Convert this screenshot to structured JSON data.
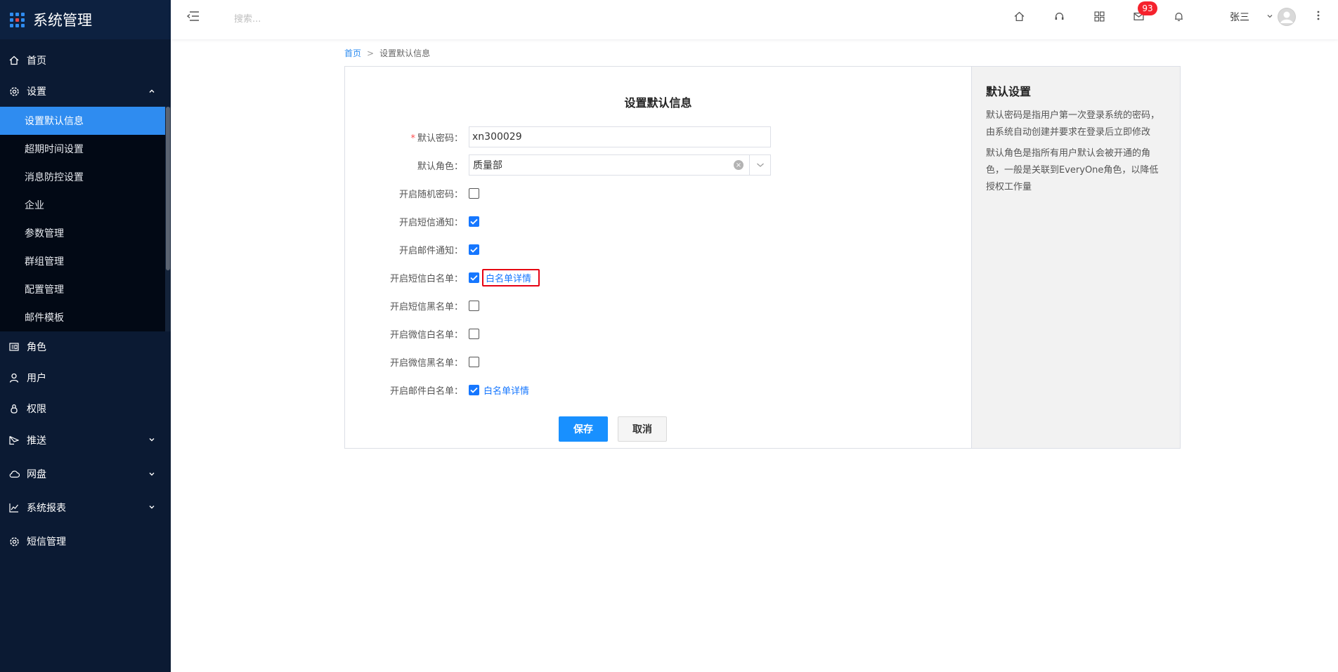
{
  "app": {
    "title": "系统管理"
  },
  "sidebar": {
    "items": [
      {
        "label": "首页",
        "icon": "home-icon"
      },
      {
        "label": "设置",
        "icon": "gear-icon",
        "expanded": true
      },
      {
        "label": "角色",
        "icon": "id-card-icon"
      },
      {
        "label": "用户",
        "icon": "user-icon"
      },
      {
        "label": "权限",
        "icon": "lock-icon"
      },
      {
        "label": "推送",
        "icon": "send-icon"
      },
      {
        "label": "网盘",
        "icon": "cloud-icon"
      },
      {
        "label": "系统报表",
        "icon": "chart-icon"
      },
      {
        "label": "短信管理",
        "icon": "gear-icon"
      }
    ],
    "settings_sub": [
      {
        "label": "设置默认信息",
        "active": true
      },
      {
        "label": "超期时间设置"
      },
      {
        "label": "消息防控设置"
      },
      {
        "label": "企业"
      },
      {
        "label": "参数管理"
      },
      {
        "label": "群组管理"
      },
      {
        "label": "配置管理"
      },
      {
        "label": "邮件模板"
      }
    ]
  },
  "header": {
    "search_placeholder": "搜索...",
    "mail_badge": "93",
    "username": "张三"
  },
  "breadcrumb": {
    "home": "首页",
    "sep": ">",
    "current": "设置默认信息"
  },
  "form": {
    "title": "设置默认信息",
    "password_label": "默认密码：",
    "password_value": "xn300029",
    "role_label": "默认角色：",
    "role_value": "质量部",
    "random_pwd_label": "开启随机密码：",
    "random_pwd": false,
    "sms_notify_label": "开启短信通知：",
    "sms_notify": true,
    "mail_notify_label": "开启邮件通知：",
    "mail_notify": true,
    "sms_whitelist_label": "开启短信白名单：",
    "sms_whitelist": true,
    "sms_whitelist_link": "白名单详情",
    "sms_blacklist_label": "开启短信黑名单：",
    "sms_blacklist": false,
    "wechat_whitelist_label": "开启微信白名单：",
    "wechat_whitelist": false,
    "wechat_blacklist_label": "开启微信黑名单：",
    "wechat_blacklist": false,
    "mail_whitelist_label": "开启邮件白名单：",
    "mail_whitelist": true,
    "mail_whitelist_link": "白名单详情",
    "save_label": "保存",
    "cancel_label": "取消"
  },
  "aside": {
    "title": "默认设置",
    "p1": "默认密码是指用户第一次登录系统的密码，由系统自动创建并要求在登录后立即修改",
    "p2": "默认角色是指所有用户默认会被开通的角色，一般是关联到EveryOne角色，以降低授权工作量"
  },
  "colors": {
    "sidebar_bg": "#0b1a33",
    "accent": "#1890ff",
    "active_item": "#2f8cf0",
    "highlight_border": "#e60012"
  }
}
